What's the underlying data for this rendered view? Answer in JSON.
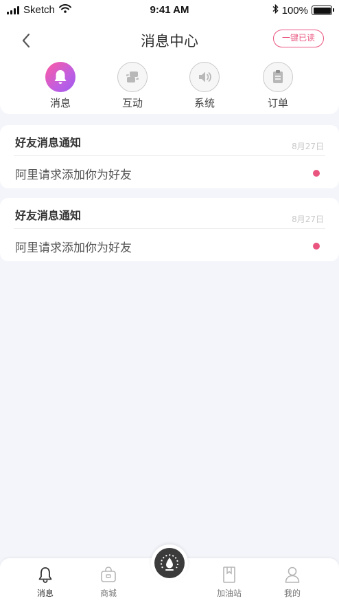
{
  "status_bar": {
    "carrier": "Sketch",
    "time": "9:41 AM",
    "battery": "100%",
    "battery_level": 1.0,
    "icons": [
      "signal-icon",
      "wifi-icon",
      "bluetooth-icon",
      "battery-icon"
    ]
  },
  "header": {
    "title": "消息中心",
    "read_all_label": "一键已读",
    "back_icon": "chevron-left-icon"
  },
  "tabs": [
    {
      "label": "消息",
      "icon": "bell-icon",
      "active": true
    },
    {
      "label": "互动",
      "icon": "chat-bubbles-icon",
      "active": false
    },
    {
      "label": "系统",
      "icon": "speaker-icon",
      "active": false
    },
    {
      "label": "订单",
      "icon": "clipboard-icon",
      "active": false
    }
  ],
  "messages": [
    {
      "title": "好友消息通知",
      "date": "8月27日",
      "text": "阿里请求添加你为好友",
      "unread": true
    },
    {
      "title": "好友消息通知",
      "date": "8月27日",
      "text": "阿里请求添加你为好友",
      "unread": true
    }
  ],
  "tabbar": {
    "items": [
      {
        "label": "消息",
        "icon": "bell-icon",
        "active": true
      },
      {
        "label": "商城",
        "icon": "shopping-bag-icon",
        "active": false
      },
      {
        "label": "加油站",
        "icon": "bookmark-icon",
        "active": false
      },
      {
        "label": "我的",
        "icon": "user-icon",
        "active": false
      }
    ],
    "center_icon": "fuel-drop-gauge-icon"
  },
  "colors": {
    "accent": "#e9557f",
    "gradient_start": "#ff5aa0",
    "gradient_end": "#9e5bf0",
    "background": "#f4f5fa"
  }
}
